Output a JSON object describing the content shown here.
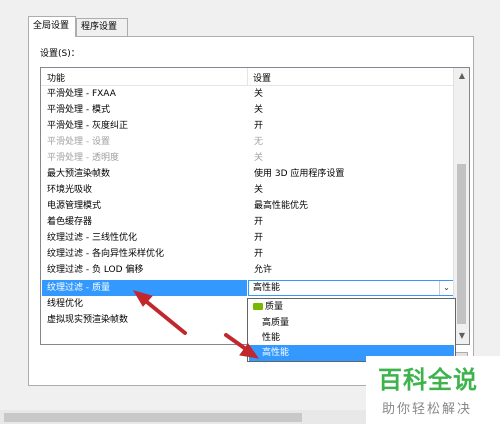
{
  "tabs": [
    {
      "label": "全局设置",
      "active": true
    },
    {
      "label": "程序设置",
      "active": false
    }
  ],
  "settings_label": "设置(S)：",
  "list": {
    "header": {
      "feature": "功能",
      "setting": "设置"
    },
    "rows": [
      {
        "feature": "平滑处理 - FXAA",
        "value": "关",
        "disabled": false
      },
      {
        "feature": "平滑处理 - 模式",
        "value": "关",
        "disabled": false
      },
      {
        "feature": "平滑处理 - 灰度纠正",
        "value": "开",
        "disabled": false
      },
      {
        "feature": "平滑处理 - 设置",
        "value": "无",
        "disabled": true
      },
      {
        "feature": "平滑处理 - 透明度",
        "value": "关",
        "disabled": true
      },
      {
        "feature": "最大预渲染帧数",
        "value": "使用 3D 应用程序设置",
        "disabled": false
      },
      {
        "feature": "环境光吸收",
        "value": "关",
        "disabled": false
      },
      {
        "feature": "电源管理模式",
        "value": "最高性能优先",
        "disabled": false
      },
      {
        "feature": "着色缓存器",
        "value": "开",
        "disabled": false
      },
      {
        "feature": "纹理过滤 - 三线性优化",
        "value": "开",
        "disabled": false
      },
      {
        "feature": "纹理过滤 - 各向异性采样优化",
        "value": "开",
        "disabled": false
      },
      {
        "feature": "纹理过滤 - 负 LOD 偏移",
        "value": "允许",
        "disabled": false
      },
      {
        "feature": "纹理过滤 - 质量",
        "value": "高性能",
        "disabled": false,
        "selected": true
      },
      {
        "feature": "线程优化",
        "value": "",
        "disabled": false
      },
      {
        "feature": "虚拟现实预渲染帧数",
        "value": "",
        "disabled": false
      }
    ]
  },
  "dropdown": {
    "header": "质量",
    "options": [
      {
        "label": "高质量",
        "selected": false
      },
      {
        "label": "性能",
        "selected": false
      },
      {
        "label": "高性能",
        "selected": true
      }
    ]
  },
  "icons": {
    "combo_arrow": "chevron-down-icon",
    "scroll_up": "triangle-up-icon",
    "scroll_down": "triangle-down-icon",
    "nvidia": "nvidia-badge-icon"
  },
  "colors": {
    "selection": "#3399ff",
    "annotation_arrow": "#c0282d",
    "nvidia_green": "#76b900",
    "watermark_green": "#3eb34c"
  },
  "watermark": {
    "title": "百科全说",
    "subtitle": "助你轻松解决"
  }
}
